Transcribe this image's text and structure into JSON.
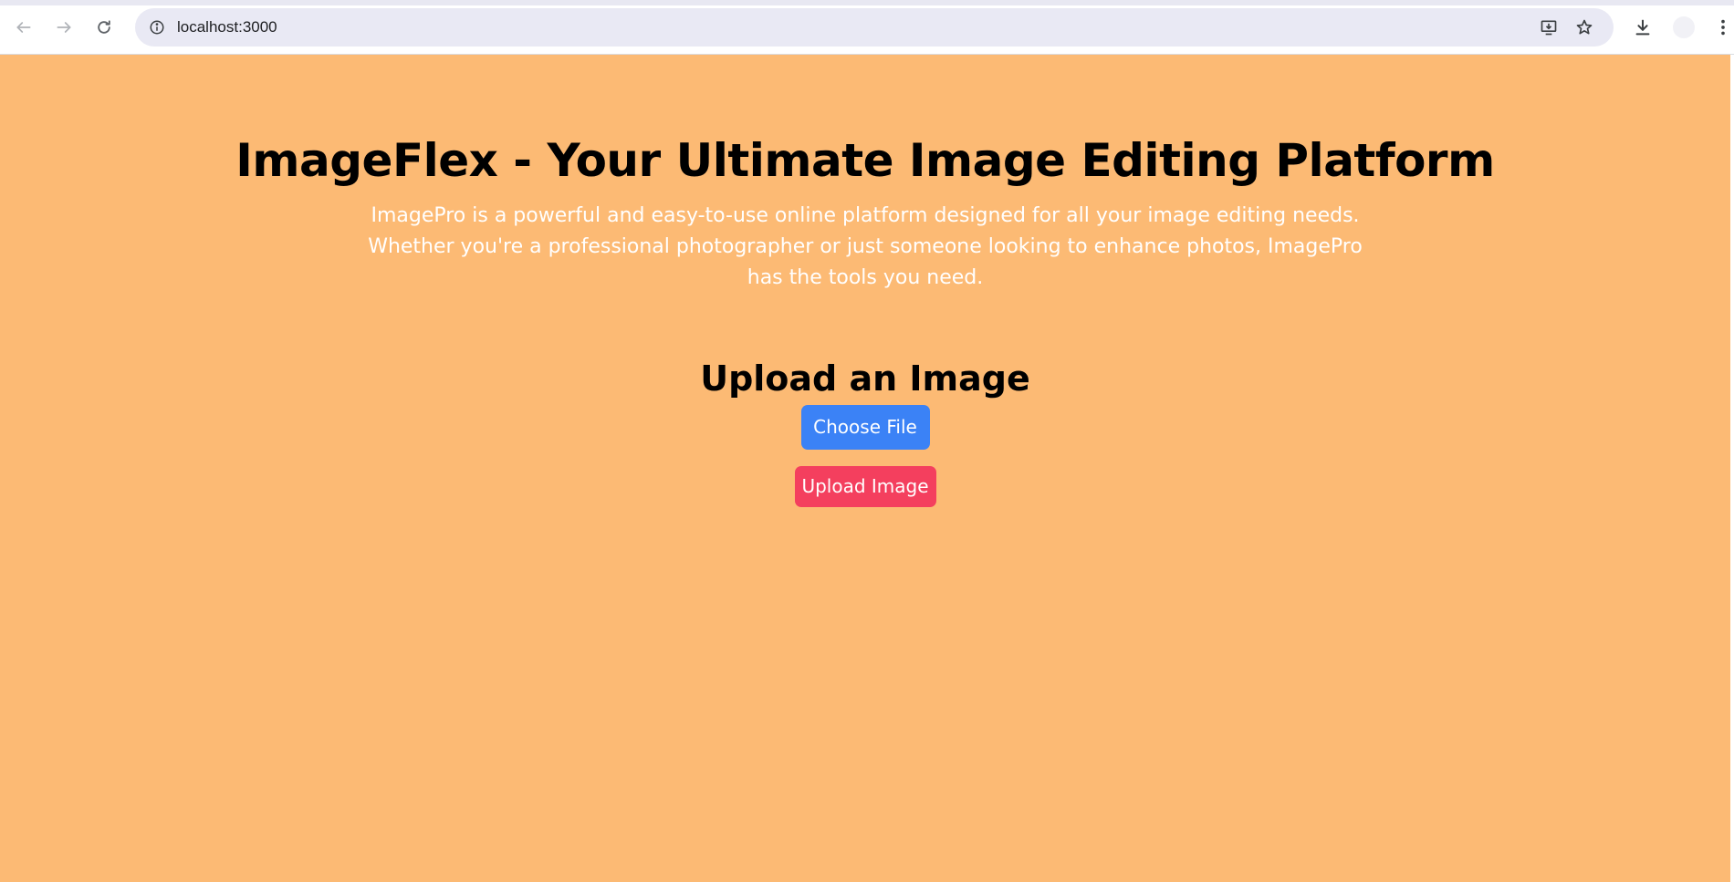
{
  "browser": {
    "url": "localhost:3000",
    "icons": {
      "back": "arrow-left-icon",
      "forward": "arrow-right-icon",
      "reload": "reload-icon",
      "site_info": "info-icon",
      "install": "install-app-icon",
      "bookmark": "star-icon",
      "downloads": "download-icon",
      "profile": "profile-avatar",
      "menu": "kebab-menu-icon"
    }
  },
  "colors": {
    "page_background": "#fcba74",
    "choose_button": "#3b82f6",
    "upload_button": "#f43f5e"
  },
  "hero": {
    "title": "ImageFlex - Your Ultimate Image Editing Platform",
    "description": "ImagePro is a powerful and easy-to-use online platform designed for all your image editing needs. Whether you're a professional photographer or just someone looking to enhance photos, ImagePro has the tools you need."
  },
  "upload": {
    "heading": "Upload an Image",
    "choose_file_label": "Choose File",
    "upload_label": "Upload Image"
  }
}
